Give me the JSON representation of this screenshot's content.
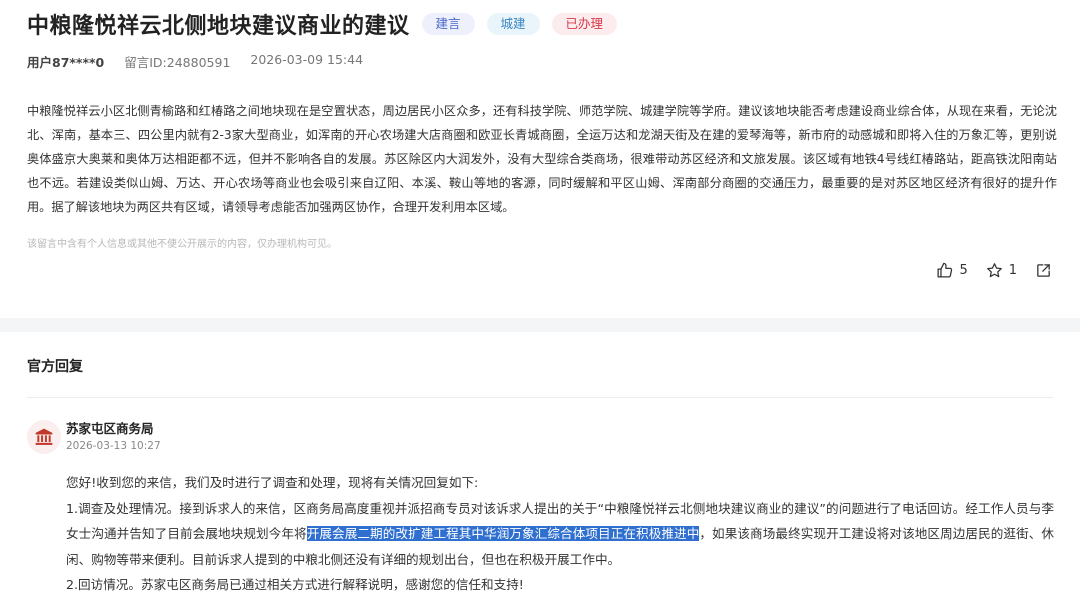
{
  "post": {
    "title": "中粮隆悦祥云北侧地块建议商业的建议",
    "tags": [
      "建言",
      "城建",
      "已办理"
    ],
    "user": "用户87****0",
    "message_id": "留言ID:24880591",
    "datetime": "2026-03-09 15:44",
    "content": "中粮隆悦祥云小区北侧青榆路和红椿路之间地块现在是空置状态，周边居民小区众多，还有科技学院、师范学院、城建学院等学府。建议该地块能否考虑建设商业综合体，从现在来看，无论沈北、浑南，基本三、四公里内就有2-3家大型商业，如浑南的开心农场建大店商圈和欧亚长青城商圈，全运万达和龙湖天街及在建的爱琴海等，新市府的动感城和即将入住的万象汇等，更别说奥体盛京大奥莱和奥体万达相距都不远，但并不影响各自的发展。苏区除区内大润发外，没有大型综合类商场，很难带动苏区经济和文旅发展。该区域有地铁4号线红椿路站，距高铁沈阳南站也不远。若建设类似山姆、万达、开心农场等商业也会吸引来自辽阳、本溪、鞍山等地的客源，同时缓解和平区山姆、浑南部分商圈的交通压力，最重要的是对苏区地区经济有很好的提升作用。据了解该地块为两区共有区域，请领导考虑能否加强两区协作，合理开发利用本区域。",
    "privacy_note": "该留言中含有个人信息或其他不便公开展示的内容，仅办理机构可见。",
    "likes": "5",
    "favorites": "1"
  },
  "reply": {
    "section_title": "官方回复",
    "org_name": "苏家屯区商务局",
    "org_time": "2026-03-13 10:27",
    "greeting": "您好!收到您的来信，我们及时进行了调查和处理，现将有关情况回复如下:",
    "para1_before": "1.调查及处理情况。接到诉求人的来信，区商务局高度重视并派招商专员对该诉求人提出的关于“中粮隆悦祥云北侧地块建议商业的建议”的问题进行了电话回访。经工作人员与李女士沟通并告知了目前会展地块规划今年将",
    "para1_highlight": "开展会展二期的改扩建工程其中华润万象汇综合体项目正在积极推进中",
    "para1_after": "，如果该商场最终实现开工建设将对该地区周边居民的逛街、休闲、购物等带来便利。目前诉求人提到的中粮北侧还没有详细的规划出台，但也在积极开展工作中。",
    "para2": "2.回访情况。苏家屯区商务局已通过相关方式进行解释说明，感谢您的信任和支持!"
  },
  "colors": {
    "accent_blue": "#2f6fd0",
    "tag_red": "#d8394a",
    "tag_blue": "#4a68c9",
    "org_icon": "#c0392b"
  }
}
